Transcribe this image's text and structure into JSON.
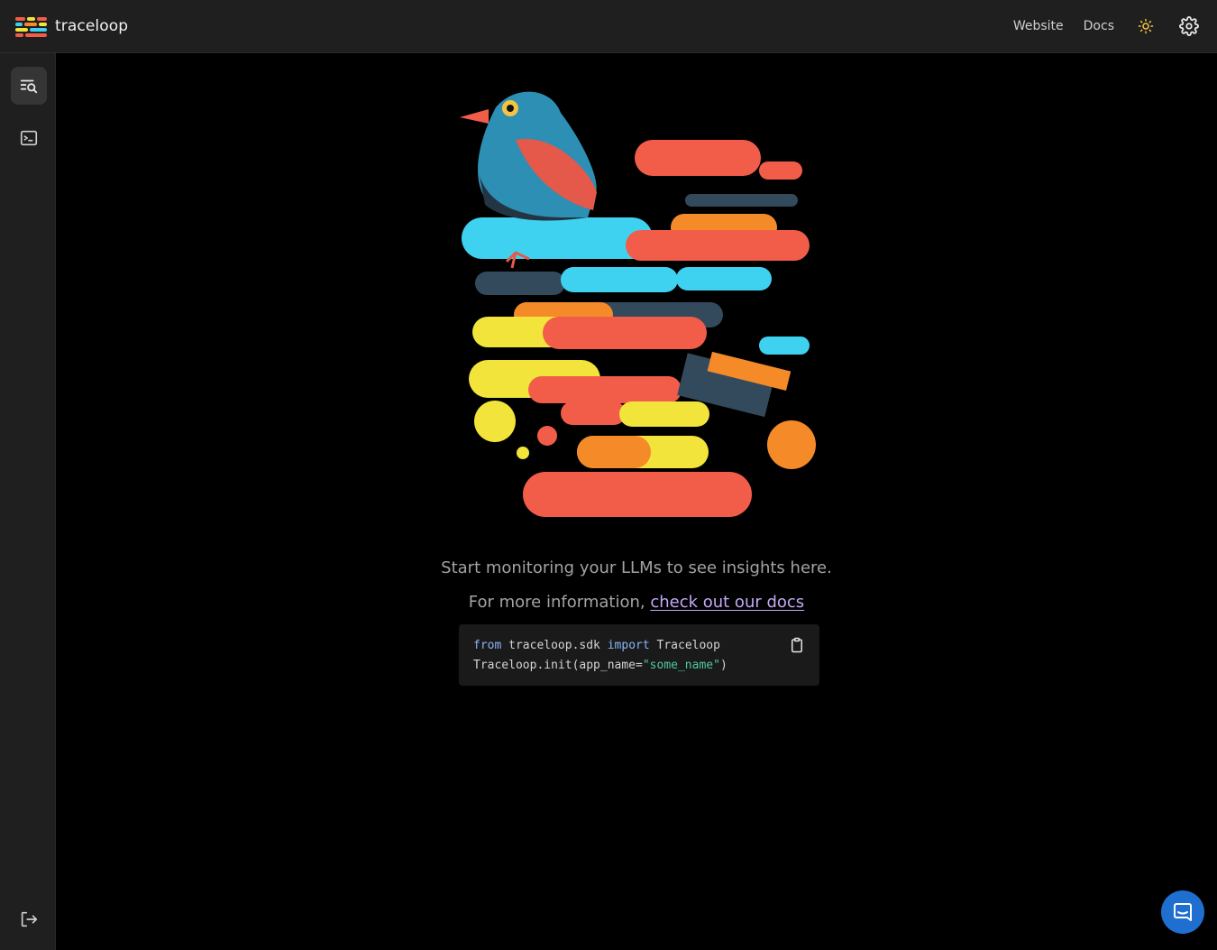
{
  "header": {
    "brand": "traceloop",
    "nav": {
      "website": "Website",
      "docs": "Docs"
    },
    "icons": {
      "logo": "traceloop-logo-icon",
      "theme": "sun-icon",
      "settings": "gear-icon"
    }
  },
  "sidebar": {
    "items": [
      {
        "name": "traces",
        "icon": "search-list-icon",
        "active": true
      },
      {
        "name": "playground",
        "icon": "terminal-icon",
        "active": false
      }
    ],
    "footer_icon": "logout-icon"
  },
  "main": {
    "illustration": "bird-on-colored-bars-illustration",
    "message": "Start monitoring your LLMs to see insights here.",
    "info_prefix": "For more information, ",
    "info_link": "check out our docs",
    "code": {
      "line1_kw1": "from",
      "line1_mod": " traceloop.sdk ",
      "line1_kw2": "import",
      "line1_name": " Traceloop",
      "line2_pre": "Traceloop.init(app_name=",
      "line2_str": "\"some_name\"",
      "line2_post": ")"
    },
    "copy_icon": "clipboard-icon"
  },
  "chat_icon": "chat-bubble-icon",
  "colors": {
    "accent_sun": "#f5c542",
    "link": "#c4a8f5",
    "chat": "#1f6fd1",
    "coral": "#f25d4a",
    "cyan": "#3ed2f0",
    "yellow": "#f2e43a",
    "orange": "#f58a28",
    "slate": "#334a5c"
  }
}
